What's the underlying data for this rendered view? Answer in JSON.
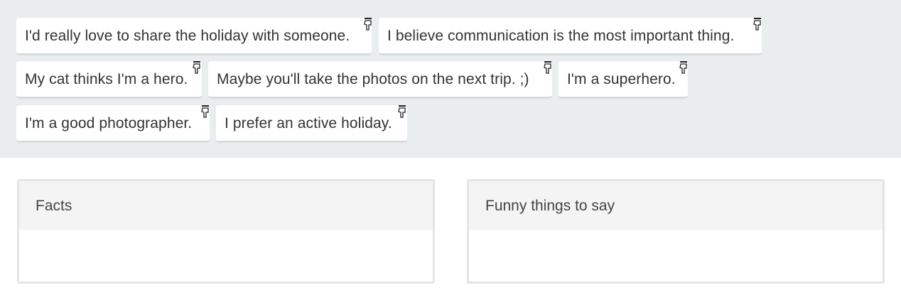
{
  "chips": [
    {
      "text": "I'd really love to share the holiday with someone.",
      "icon": "hand-point-down-icon"
    },
    {
      "text": "I believe communication is the most important thing.",
      "icon": "hand-point-down-icon"
    },
    {
      "text": "My cat thinks I'm a hero.",
      "icon": "hand-point-down-icon"
    },
    {
      "text": "Maybe you'll take the photos on the next trip. ;)",
      "icon": "hand-point-down-icon"
    },
    {
      "text": "I'm a superhero.",
      "icon": "hand-point-down-icon"
    },
    {
      "text": "I'm a good photographer.",
      "icon": "hand-point-down-icon"
    },
    {
      "text": "I prefer an active holiday.",
      "icon": "hand-point-down-icon"
    }
  ],
  "categories": [
    {
      "title": "Facts"
    },
    {
      "title": "Funny things to say"
    }
  ],
  "colors": {
    "pool_background": "#e9edee",
    "chip_background": "#ffffff",
    "header_background": "#f4f4f4",
    "border": "#e4e4e4",
    "text": "#333333"
  }
}
